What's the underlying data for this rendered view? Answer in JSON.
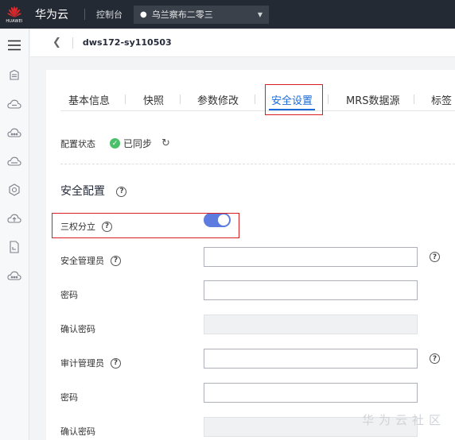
{
  "topbar": {
    "logo_text": "HUAWEI",
    "brand": "华为云",
    "console_label": "控制台",
    "region": "乌兰察布二零三"
  },
  "breadcrumb": {
    "title": "dws172-sy110503"
  },
  "tabs": [
    {
      "label": "基本信息"
    },
    {
      "label": "快照"
    },
    {
      "label": "参数修改"
    },
    {
      "label": "安全设置",
      "active": true
    },
    {
      "label": "MRS数据源"
    },
    {
      "label": "标签"
    }
  ],
  "config_status": {
    "label": "配置状态",
    "value": "已同步"
  },
  "section": {
    "title": "安全配置"
  },
  "separation": {
    "label": "三权分立",
    "enabled": true
  },
  "fields": {
    "security_admin_label": "安全管理员",
    "security_password_label": "密码",
    "security_confirm_label": "确认密码",
    "audit_admin_label": "审计管理员",
    "audit_password_label": "密码",
    "audit_confirm_label": "确认密码"
  },
  "watermark": "华为云社区",
  "colors": {
    "accent": "#1a6bd8",
    "toggle": "#5e7ce0",
    "highlight": "#d81e1e",
    "success": "#4bc06a"
  }
}
